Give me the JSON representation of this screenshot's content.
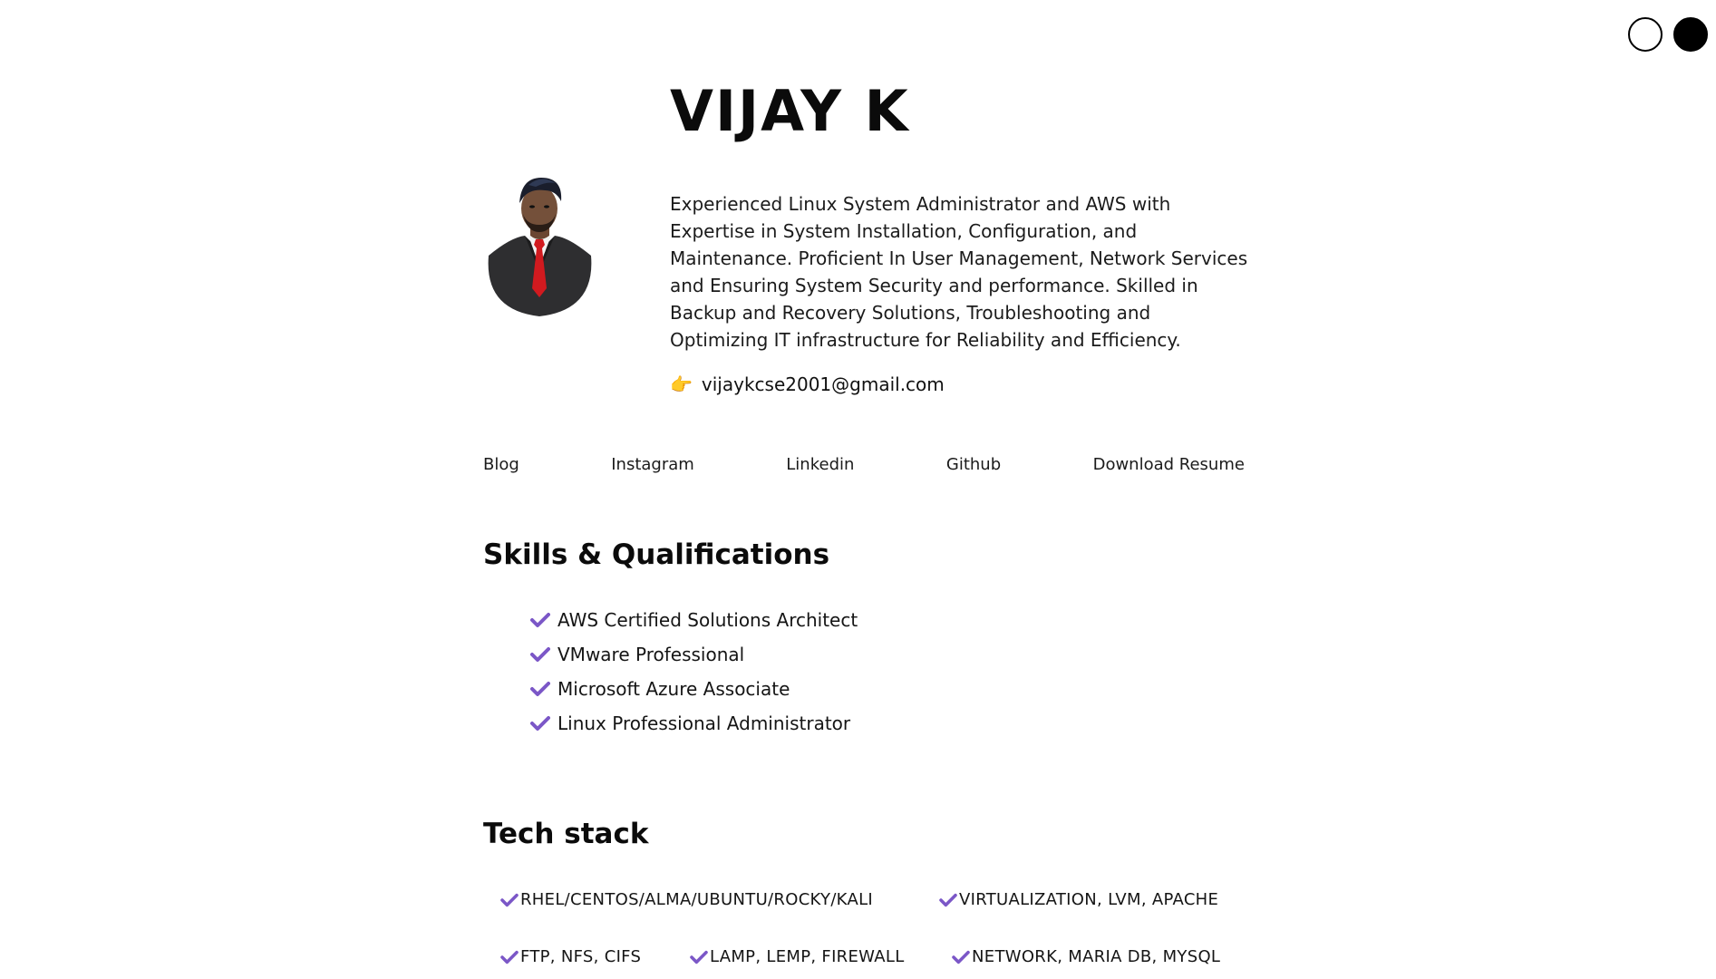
{
  "header": {
    "name": "VIJAY K"
  },
  "theme": {
    "light_color": "#ffffff",
    "dark_color": "#000000"
  },
  "profile": {
    "bio": "Experienced Linux System Administrator and AWS with Expertise in System Installation, Configuration, and Maintenance. Proficient In User Management, Network Services and Ensuring System Security and performance. Skilled in Backup and Recovery Solutions, Troubleshooting and Optimizing IT infrastructure for Reliability and Efficiency.",
    "email_icon": "👉",
    "email": "vijaykcse2001@gmail.com"
  },
  "nav": {
    "items": [
      {
        "label": "Blog"
      },
      {
        "label": "Instagram"
      },
      {
        "label": "Linkedin"
      },
      {
        "label": "Github"
      },
      {
        "label": "Download Resume"
      }
    ]
  },
  "skills": {
    "title": "Skills & Qualifications",
    "items": [
      {
        "label": "AWS Certified Solutions Architect"
      },
      {
        "label": "VMware Professional"
      },
      {
        "label": "Microsoft Azure Associate"
      },
      {
        "label": "Linux Professional Administrator"
      }
    ]
  },
  "tech": {
    "title": "Tech stack",
    "items": [
      {
        "label": "RHEL/CENTOS/ALMA/UBUNTU/ROCKY/KALI"
      },
      {
        "label": "VIRTUALIZATION, LVM, APACHE"
      },
      {
        "label": "FTP, NFS, CIFS"
      },
      {
        "label": "LAMP, LEMP, FIREWALL"
      },
      {
        "label": "NETWORK, MARIA DB, MYSQL"
      }
    ]
  },
  "accent_color": "#7b57c7"
}
